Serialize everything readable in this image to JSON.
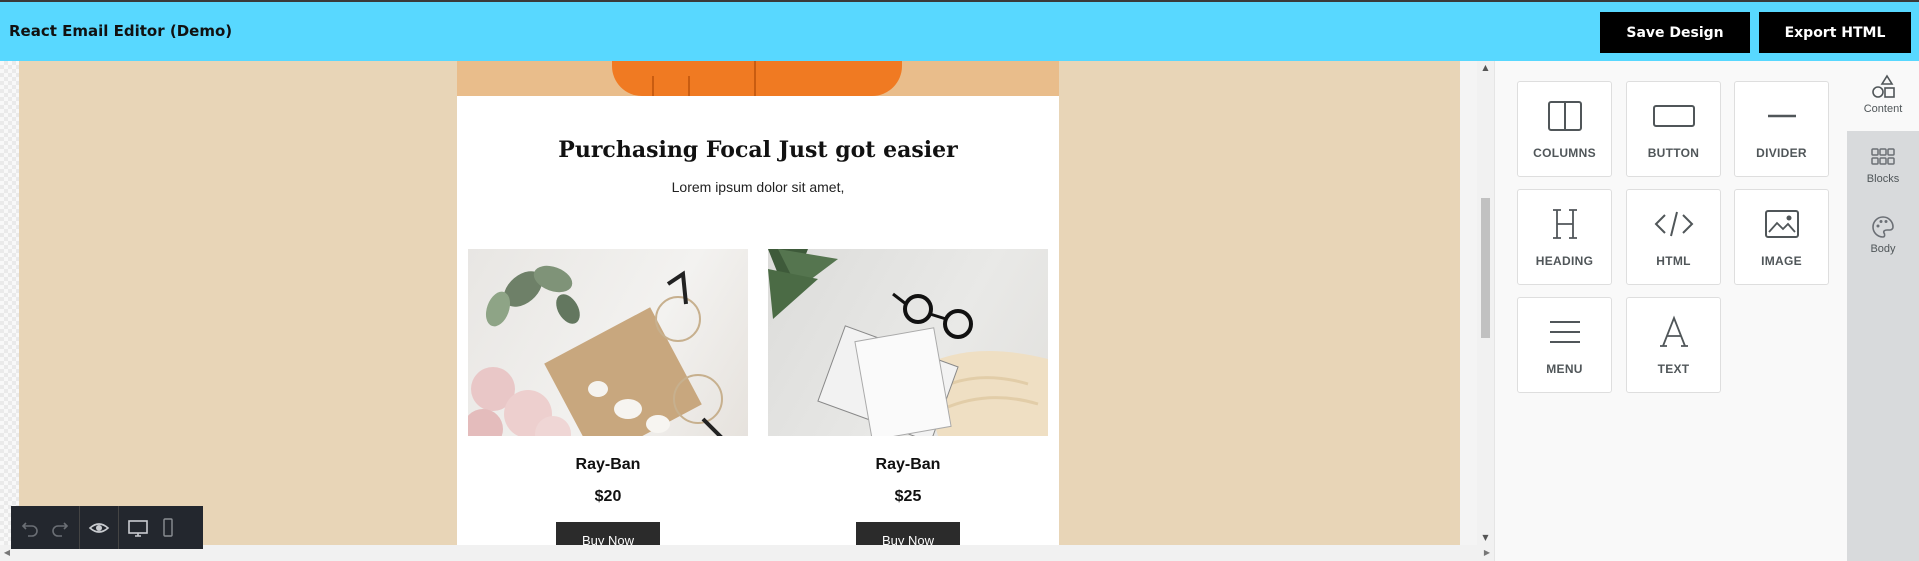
{
  "app": {
    "title": "React Email Editor (Demo)",
    "save_label": "Save Design",
    "export_label": "Export HTML"
  },
  "email": {
    "heading": "Purchasing Focal Just got easier",
    "subheading": "Lorem ipsum dolor sit amet,",
    "products": [
      {
        "name": "Ray-Ban",
        "price": "$20",
        "button": "Buy Now"
      },
      {
        "name": "Ray-Ban",
        "price": "$25",
        "button": "Buy Now"
      }
    ]
  },
  "tools": [
    {
      "label": "COLUMNS",
      "icon": "columns-icon"
    },
    {
      "label": "BUTTON",
      "icon": "button-icon"
    },
    {
      "label": "DIVIDER",
      "icon": "divider-icon"
    },
    {
      "label": "HEADING",
      "icon": "heading-icon"
    },
    {
      "label": "HTML",
      "icon": "code-icon"
    },
    {
      "label": "IMAGE",
      "icon": "image-icon"
    },
    {
      "label": "MENU",
      "icon": "menu-icon"
    },
    {
      "label": "TEXT",
      "icon": "text-icon"
    }
  ],
  "tabs": [
    {
      "label": "Content",
      "icon": "shapes-icon",
      "active": true
    },
    {
      "label": "Blocks",
      "icon": "grid-icon",
      "active": false
    },
    {
      "label": "Body",
      "icon": "palette-icon",
      "active": false
    }
  ],
  "toolbar": {
    "icons": [
      "undo-icon",
      "redo-icon",
      "preview-eye-icon",
      "desktop-icon",
      "mobile-icon"
    ]
  },
  "colors": {
    "header": "#58d8ff",
    "email_background": "#e8d5b7",
    "button": "#000000"
  }
}
